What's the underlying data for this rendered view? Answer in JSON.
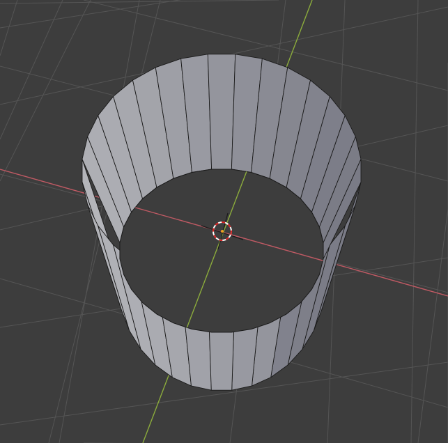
{
  "viewport": {
    "background": "#3d3d3d",
    "grid_color": "#555555",
    "x_axis_color": "#c05a64",
    "y_axis_color": "#8cac3c"
  },
  "object": {
    "type": "cylinder",
    "faces_visible": "open-top",
    "segment_count": 32,
    "face_light": "#b4b5ba",
    "face_dark": "#7a7b86",
    "edge_color": "#1a1a1a"
  },
  "cursor": {
    "name": "3d-cursor",
    "ring_red": "#d81e1e",
    "ring_white": "#ffffff"
  }
}
